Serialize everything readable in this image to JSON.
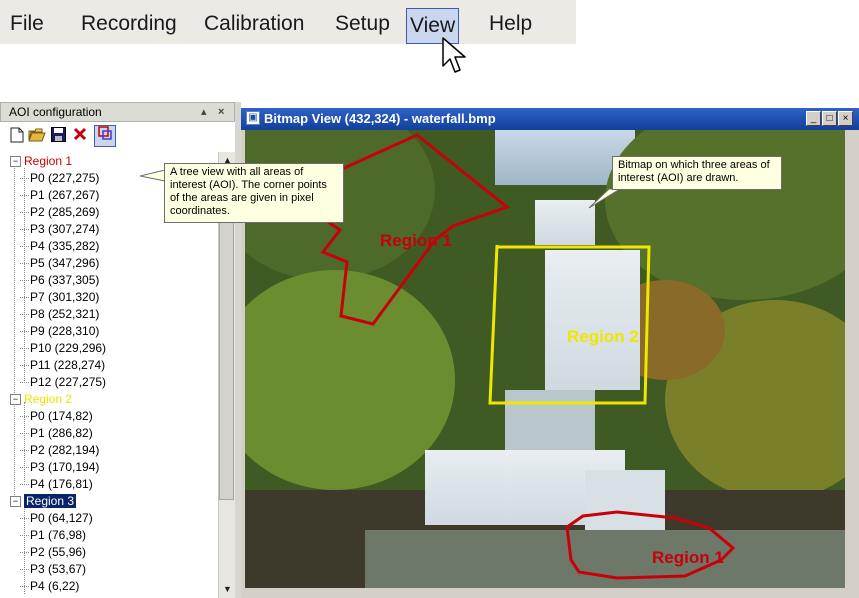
{
  "menu": {
    "items": [
      {
        "label": "File"
      },
      {
        "label": "Recording"
      },
      {
        "label": "Calibration"
      },
      {
        "label": "Setup"
      },
      {
        "label": "View"
      },
      {
        "label": "Help"
      }
    ],
    "active_index": 4
  },
  "aoi_panel": {
    "title": "AOI configuration",
    "pin_glyph": "▴",
    "close_glyph": "×",
    "toolbar_icons": [
      "new-file-icon",
      "open-folder-icon",
      "save-disk-icon",
      "delete-x-icon",
      "region-tool-icon"
    ],
    "regions": [
      {
        "name": "Region 1",
        "color": "#cc0000",
        "selected": false,
        "points": [
          "P0 (227,275)",
          "P1 (267,267)",
          "P2 (285,269)",
          "P3 (307,274)",
          "P4 (335,282)",
          "P5 (347,296)",
          "P6 (337,305)",
          "P7 (301,320)",
          "P8 (252,321)",
          "P9 (228,310)",
          "P10 (229,296)",
          "P11 (228,274)",
          "P12 (227,275)"
        ]
      },
      {
        "name": "Region 2",
        "color": "#e6e600",
        "selected": false,
        "points": [
          "P0 (174,82)",
          "P1 (286,82)",
          "P2 (282,194)",
          "P3 (170,194)",
          "P4 (176,81)"
        ]
      },
      {
        "name": "Region 3",
        "color": "#ffffff",
        "selected": true,
        "points": [
          "P0 (64,127)",
          "P1 (76,98)",
          "P2 (55,96)",
          "P3 (53,67)",
          "P4 (6,22)"
        ]
      }
    ]
  },
  "bitmap_window": {
    "title": "Bitmap View (432,324) - waterfall.bmp",
    "minimize_glyph": "_",
    "maximize_glyph": "□",
    "close_glyph": "×",
    "overlay_labels": {
      "region_1_top": "Region 1",
      "region_2": "Region 2",
      "region_1_bottom": "Region 1"
    },
    "colors": {
      "region_red": "#cc0000",
      "region_yellow": "#f0e600"
    }
  },
  "callouts": {
    "tree": "A tree view with all areas of interest (AOI). The corner points of the areas are given in pixel coordinates.",
    "bitmap": "Bitmap on which three areas of interest (AOI) are drawn."
  }
}
